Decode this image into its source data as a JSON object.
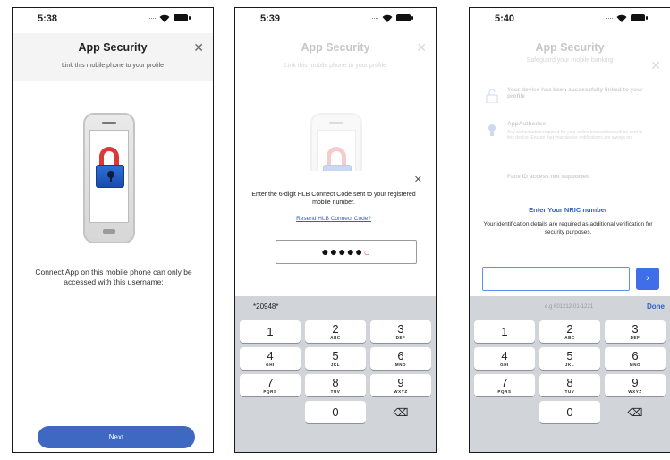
{
  "screen1": {
    "status_time": "5:38",
    "title": "App Security",
    "subtitle": "Link this mobile phone to your profile",
    "message": "Connect App on this mobile phone can only be accessed with this username:",
    "next_label": "Next"
  },
  "screen2": {
    "status_time": "5:39",
    "title": "App Security",
    "subtitle": "Link this mobile phone to your profile",
    "modal_message": "Enter the 6-digit HLB Connect Code sent to your registered mobile number.",
    "resend_label": "Resend HLB Connect Code?",
    "code_filled": "●●●●●",
    "code_empty": "○",
    "suggestion": "*20948*"
  },
  "screen3": {
    "status_time": "5:40",
    "title": "App Security",
    "subtitle": "Safeguard your mobile banking",
    "rows": [
      {
        "title": "Your device has been successfully linked to your profile",
        "desc": ""
      },
      {
        "title": "AppAuthorise",
        "desc": "Any authorisation required for your online transactions will be sent to this device. Ensure that your device notifications are always on."
      },
      {
        "title": "Face ID access not supported",
        "desc": ""
      }
    ],
    "modal_title": "Enter Your NRIC number",
    "modal_desc": "Your identification details are required as additional verification for security purposes.",
    "placeholder": "e.g 601212-01-1221",
    "done_label": "Done"
  },
  "keypad": [
    {
      "n": "1",
      "l": ""
    },
    {
      "n": "2",
      "l": "ABC"
    },
    {
      "n": "3",
      "l": "DEF"
    },
    {
      "n": "4",
      "l": "GHI"
    },
    {
      "n": "5",
      "l": "JKL"
    },
    {
      "n": "6",
      "l": "MNO"
    },
    {
      "n": "7",
      "l": "PQRS"
    },
    {
      "n": "8",
      "l": "TUV"
    },
    {
      "n": "9",
      "l": "WXYZ"
    },
    {
      "n": "0",
      "l": ""
    }
  ],
  "colors": {
    "accent": "#3f68c2",
    "lock_red": "#d83a3a",
    "link_blue": "#2d5fd0"
  }
}
